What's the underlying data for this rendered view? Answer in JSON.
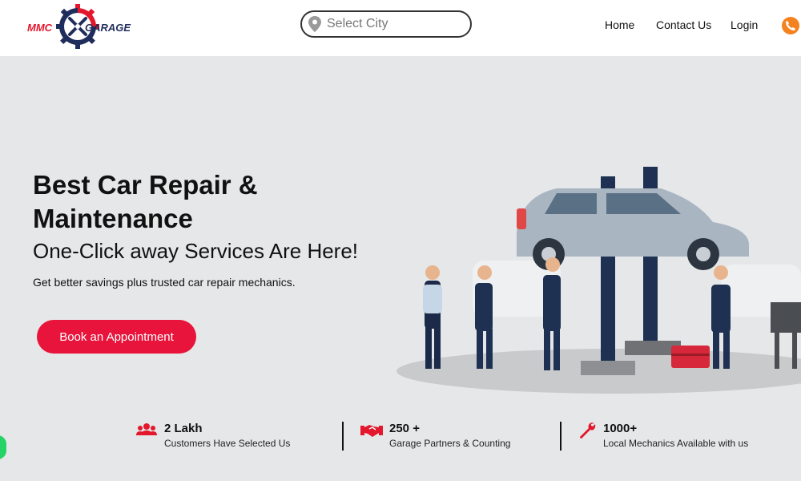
{
  "header": {
    "logo_left": "MMC",
    "logo_right": "GARAGE",
    "city_placeholder": "Select City",
    "nav": {
      "home": "Home",
      "contact": "Contact Us",
      "login": "Login"
    }
  },
  "hero": {
    "title": "Best Car Repair & Maintenance",
    "subtitle": "One-Click away Services Are Here!",
    "description": "Get better savings plus trusted car repair mechanics.",
    "cta": "Book an Appointment"
  },
  "stats": [
    {
      "number": "2 Lakh",
      "label": "Customers Have Selected Us",
      "icon": "users-icon"
    },
    {
      "number": "250 +",
      "label": "Garage Partners & Counting",
      "icon": "handshake-icon"
    },
    {
      "number": "1000+",
      "label": "Local Mechanics Available with us",
      "icon": "wrench-icon"
    }
  ],
  "colors": {
    "accent": "#e8143b",
    "brand_red": "#e3182d",
    "brand_navy": "#1f2d5c",
    "hero_bg": "#e6e7e9",
    "phone": "#f58220",
    "whatsapp": "#25d366"
  }
}
